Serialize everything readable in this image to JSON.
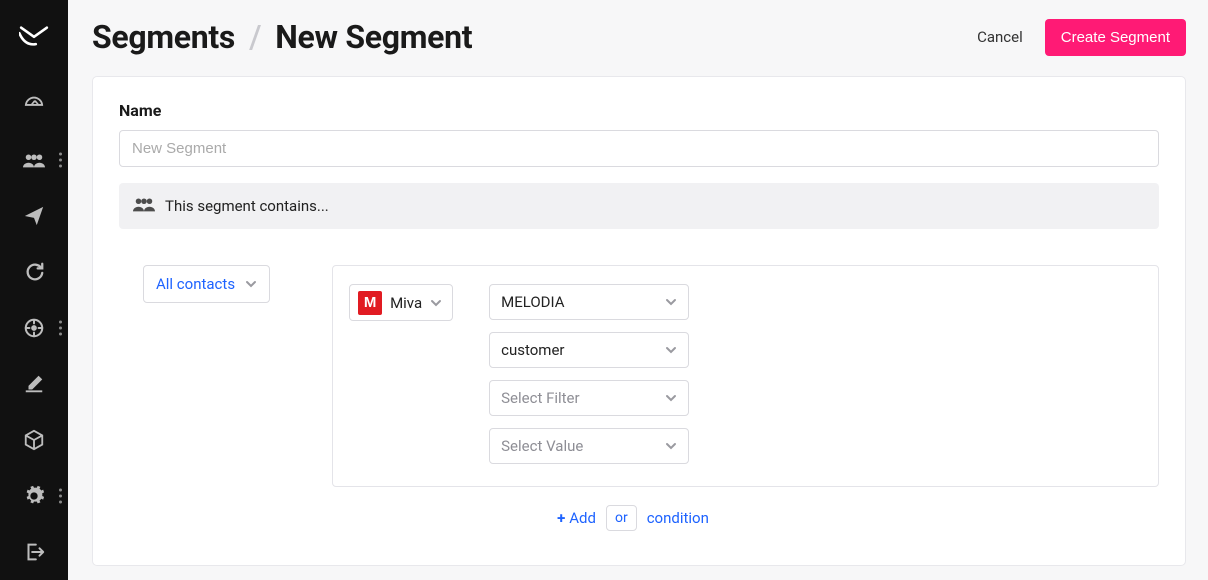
{
  "breadcrumb": {
    "root": "Segments",
    "sep": "/",
    "current": "New Segment"
  },
  "actions": {
    "cancel": "Cancel",
    "create": "Create Segment"
  },
  "form": {
    "name_label": "Name",
    "name_placeholder": "New Segment",
    "banner_text": "This segment contains..."
  },
  "builder": {
    "contacts_dropdown": "All contacts",
    "source": {
      "badge": "M",
      "label": "Miva"
    },
    "selects": [
      {
        "value": "MELODIA",
        "placeholder": false
      },
      {
        "value": "customer",
        "placeholder": false
      },
      {
        "value": "Select Filter",
        "placeholder": true
      },
      {
        "value": "Select Value",
        "placeholder": true
      }
    ],
    "add": {
      "add": "Add",
      "or": "or",
      "condition": "condition"
    }
  },
  "sidebar": {
    "items": [
      {
        "icon": "gauge"
      },
      {
        "icon": "people",
        "dots": true
      },
      {
        "icon": "paper-plane"
      },
      {
        "icon": "sync"
      },
      {
        "icon": "target",
        "dots": true
      },
      {
        "icon": "edit"
      },
      {
        "icon": "box"
      },
      {
        "icon": "gear",
        "dots": true
      },
      {
        "icon": "exit"
      }
    ]
  }
}
